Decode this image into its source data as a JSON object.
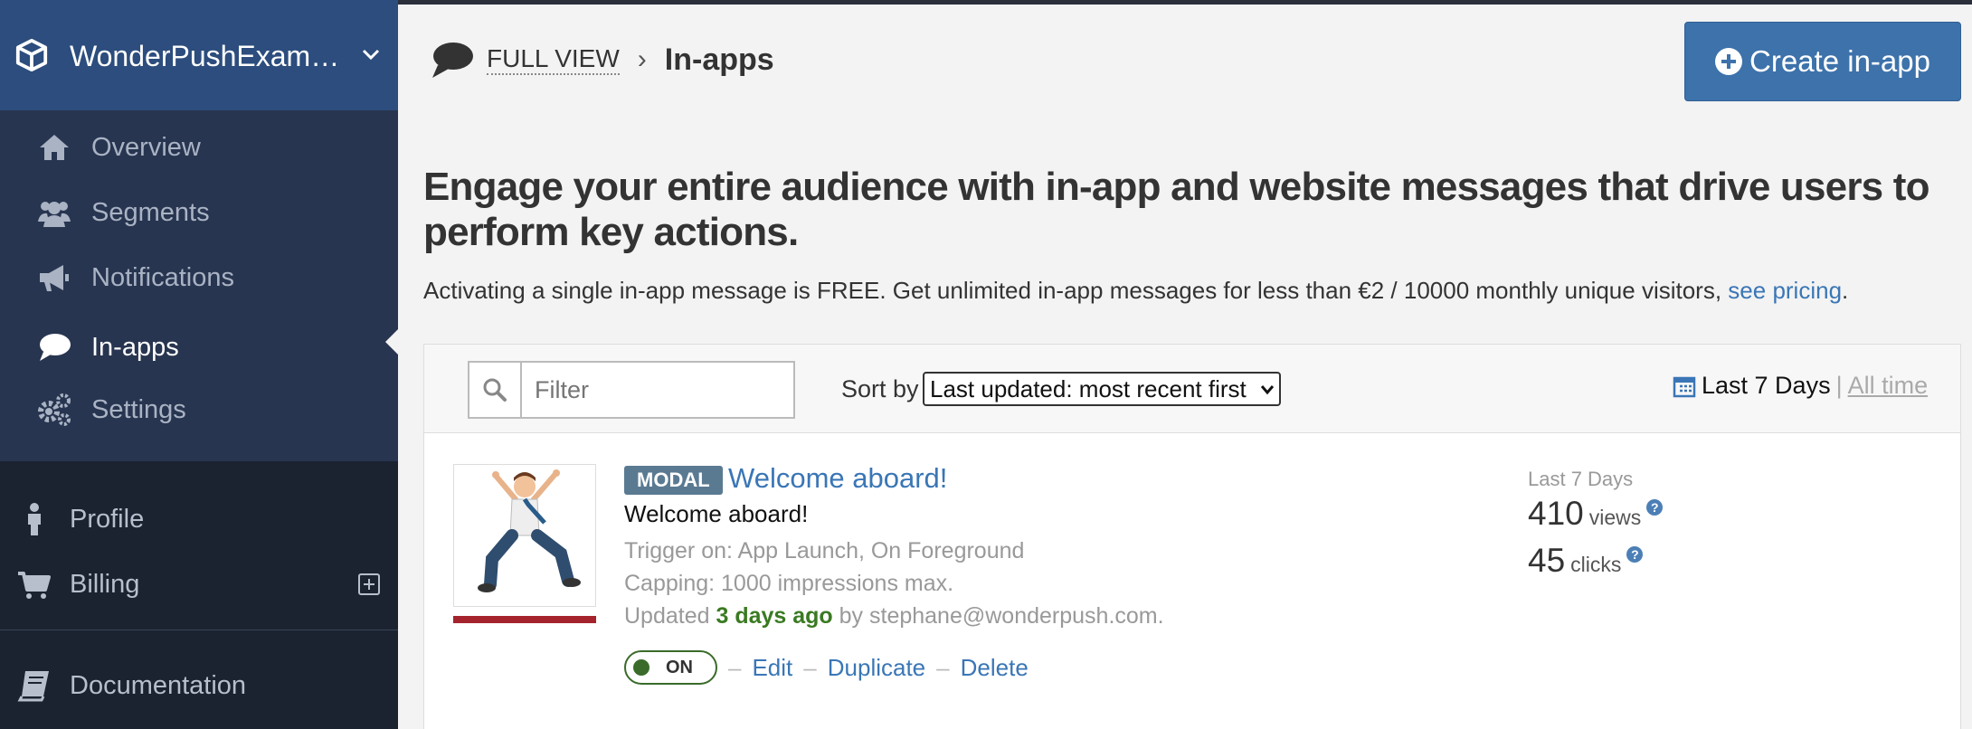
{
  "colors": {
    "sidebar_header": "#2c4d7d",
    "sidebar_main": "#283550",
    "sidebar_lower": "#1b2230",
    "primary_button": "#3d72ab",
    "link": "#3a76b6",
    "badge": "#5a7a92",
    "active_green": "#3a6b2a",
    "thumb_bar": "#a5232c"
  },
  "sidebar": {
    "app_name": "WonderPushExam…",
    "app_icon": "cube-icon",
    "nav": [
      {
        "label": "Overview",
        "icon": "home-icon"
      },
      {
        "label": "Segments",
        "icon": "users-icon"
      },
      {
        "label": "Notifications",
        "icon": "bullhorn-icon"
      },
      {
        "label": "In-apps",
        "icon": "comment-icon",
        "active": true
      },
      {
        "label": "Settings",
        "icon": "cogs-icon"
      }
    ],
    "lower": [
      {
        "label": "Profile",
        "icon": "person-icon"
      },
      {
        "label": "Billing",
        "icon": "cart-icon"
      },
      {
        "label": "Documentation",
        "icon": "book-icon"
      }
    ]
  },
  "header": {
    "breadcrumb_root": "FULL VIEW",
    "breadcrumb_sep": "›",
    "breadcrumb_current": "In-apps",
    "create_button": "Create in-app"
  },
  "intro": {
    "headline": "Engage your entire audience with in-app and website messages that drive users to perform key actions.",
    "text": "Activating a single in-app message is FREE. Get unlimited in-app messages for less than €2 / 10000 monthly unique visitors, ",
    "link": "see pricing",
    "after_link": "."
  },
  "toolbar": {
    "filter_placeholder": "Filter",
    "sort_label": "Sort by",
    "sort_value": "Last updated: most recent first",
    "range_current": "Last 7 Days",
    "range_sep": "|",
    "range_alt": "All time"
  },
  "inapp": {
    "badge": "MODAL",
    "title": "Welcome aboard!",
    "subtitle": "Welcome aboard!",
    "trigger": "Trigger on: App Launch, On Foreground",
    "capping": "Capping: 1000 impressions max.",
    "updated_prefix": "Updated ",
    "updated_ago": "3 days ago",
    "updated_suffix": " by stephane@wonderpush.com.",
    "toggle": "ON",
    "dash": "–",
    "edit": "Edit",
    "duplicate": "Duplicate",
    "delete": "Delete",
    "stats_period": "Last 7 Days",
    "views_count": "410",
    "views_unit": "views",
    "clicks_count": "45",
    "clicks_unit": "clicks",
    "help_mark": "?"
  }
}
